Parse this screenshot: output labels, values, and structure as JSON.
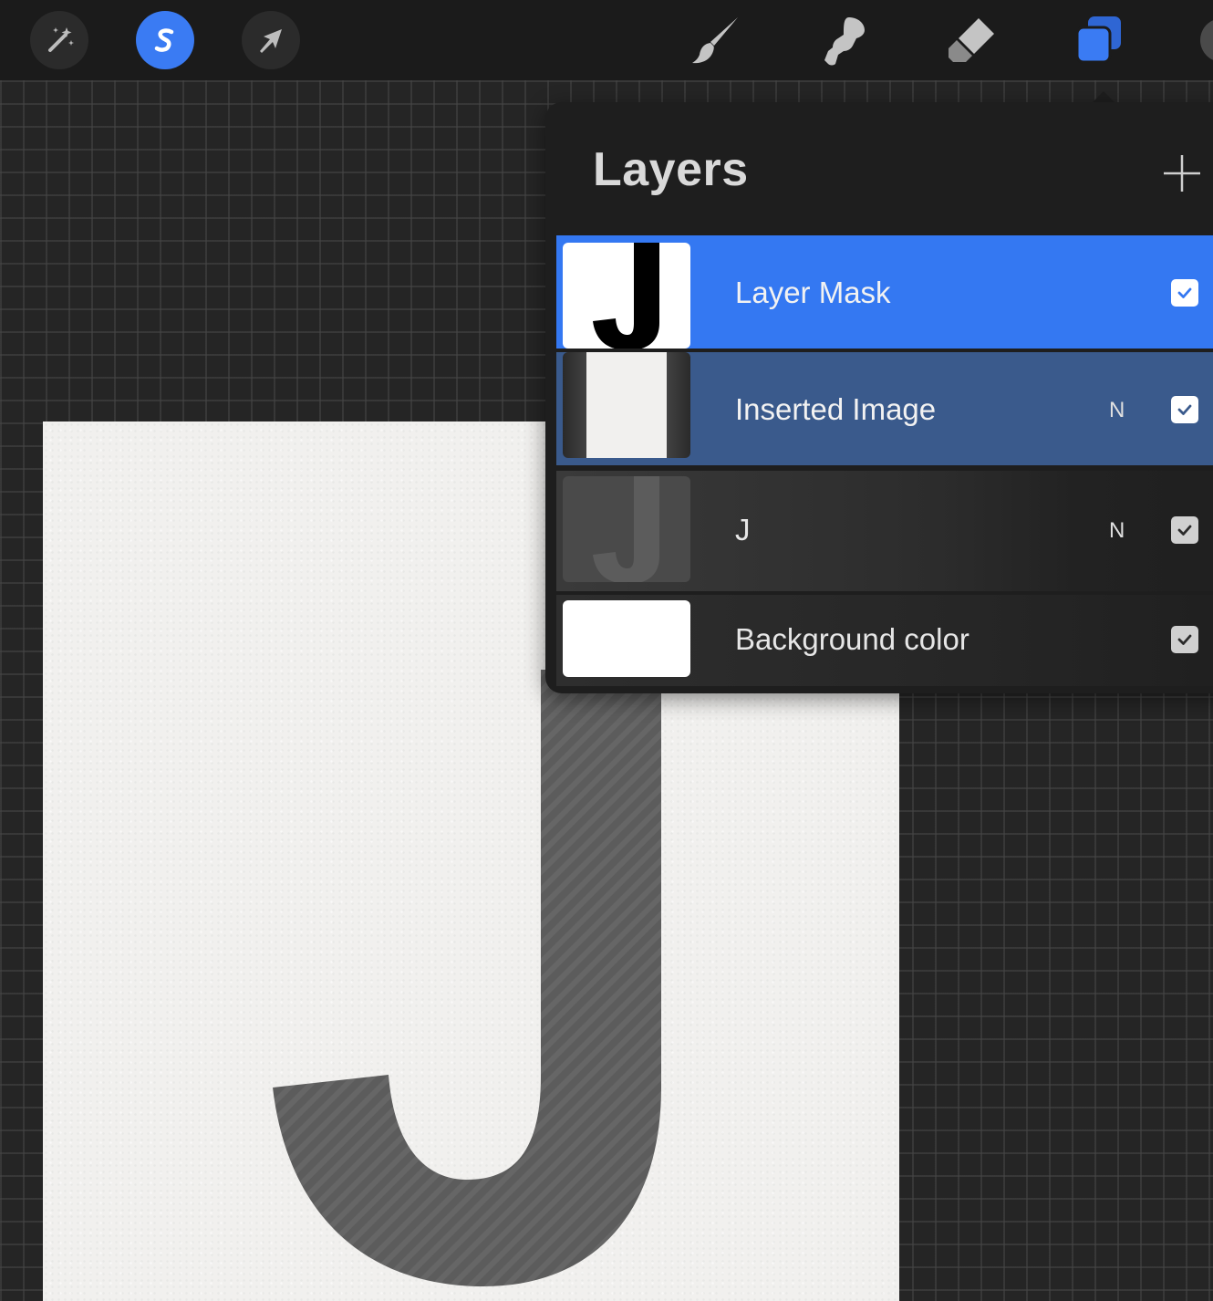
{
  "toolbar": {
    "left_tools": [
      {
        "icon": "magic-wand-icon",
        "state": "inactive"
      },
      {
        "icon": "selection-icon",
        "state": "active"
      },
      {
        "icon": "transform-arrow-icon",
        "state": "inactive"
      }
    ],
    "right_tools": [
      {
        "icon": "brush-icon"
      },
      {
        "icon": "smudge-icon"
      },
      {
        "icon": "eraser-icon"
      },
      {
        "icon": "layers-icon",
        "state": "active"
      }
    ],
    "accent_color": "#3a7bf3"
  },
  "layers_panel": {
    "title": "Layers",
    "add_icon": "plus-icon",
    "layers": [
      {
        "name": "Layer Mask",
        "blend": "",
        "visible": true,
        "state": "selected"
      },
      {
        "name": "Inserted Image",
        "blend": "N",
        "visible": true,
        "state": "clipped-parent"
      },
      {
        "name": "J",
        "blend": "N",
        "visible": true,
        "state": "normal"
      },
      {
        "name": "Background color",
        "blend": "",
        "visible": true,
        "state": "normal"
      }
    ]
  },
  "canvas": {
    "content": "J",
    "paper_color": "#f1f0ee",
    "glyph_color": "#5a5a5a"
  }
}
